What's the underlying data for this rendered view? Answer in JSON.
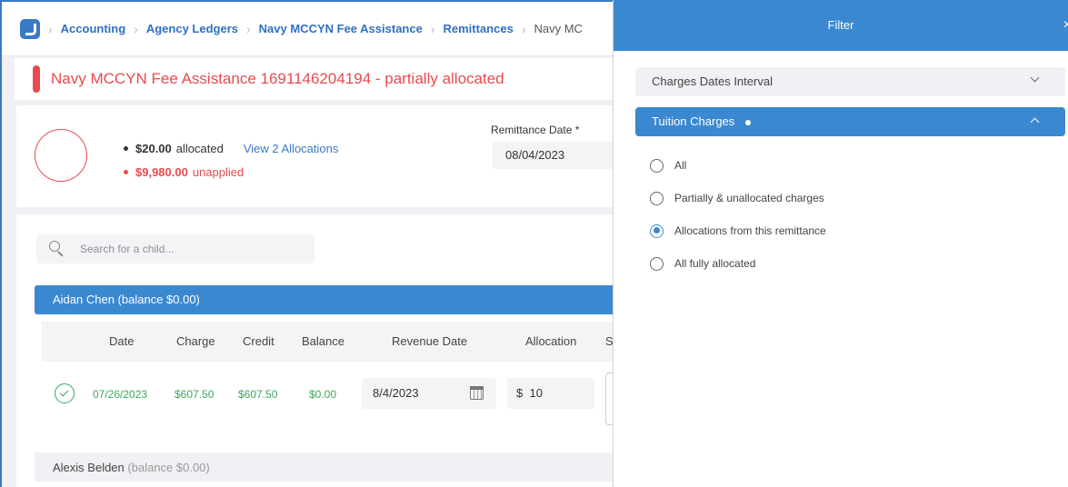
{
  "breadcrumb": {
    "items": [
      "Accounting",
      "Agency Ledgers",
      "Navy MCCYN Fee Assistance",
      "Remittances"
    ],
    "current": "Navy MC"
  },
  "page": {
    "title": "Navy MCCYN Fee Assistance 1691146204194 - partially allocated"
  },
  "summary": {
    "allocated_amount": "$20.00",
    "allocated_label": "allocated",
    "view_link": "View 2 Allocations",
    "unapplied_amount": "$9,980.00",
    "unapplied_label": "unapplied",
    "remittance_date_label": "Remittance Date *",
    "remittance_date_value": "08/04/2023"
  },
  "search": {
    "placeholder": "Search for a child..."
  },
  "groups": [
    {
      "name": "Aidan Chen (balance $0.00)"
    },
    {
      "name": "Alexis Belden",
      "balance": "(balance $0.00)"
    }
  ],
  "table": {
    "headers": [
      "Date",
      "Charge",
      "Credit",
      "Balance",
      "Revenue Date",
      "Allocation",
      "S"
    ],
    "rows": [
      {
        "date": "07/26/2023",
        "charge": "$607.50",
        "credit": "$607.50",
        "balance": "$0.00",
        "revenue_date": "8/4/2023",
        "currency": "$",
        "allocation": "10"
      }
    ]
  },
  "filter": {
    "title": "Filter",
    "close": "×",
    "charges_dates_label": "Charges Dates Interval",
    "tuition_label": "Tuition Charges",
    "options": [
      {
        "label": "All",
        "checked": false
      },
      {
        "label": "Partially & unallocated charges",
        "checked": false
      },
      {
        "label": "Allocations from this remittance",
        "checked": true
      },
      {
        "label": "All fully allocated",
        "checked": false
      }
    ]
  },
  "colors": {
    "accent": "#3a88d0",
    "danger": "#e94a4f",
    "success": "#3da65c"
  }
}
